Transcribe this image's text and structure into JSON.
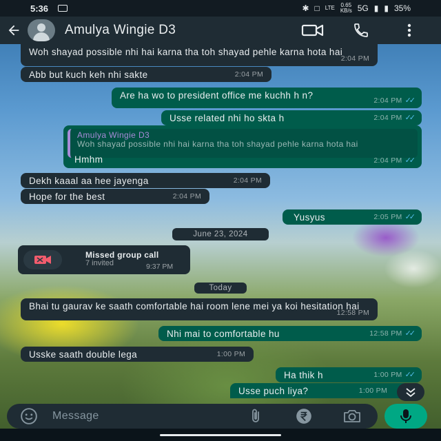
{
  "status_bar": {
    "time": "5:36",
    "lte_label": "LTE",
    "speed_value": "0.65",
    "speed_unit": "KB/s",
    "network": "5G",
    "battery": "35%"
  },
  "header": {
    "contact_name": "Amulya Wingie D3",
    "icons": [
      "back-arrow-icon",
      "avatar",
      "video-call-icon",
      "phone-icon",
      "more-options-icon"
    ]
  },
  "messages": [
    {
      "dir": "in",
      "text": "Woh shayad possible nhi hai karna tha toh shayad pehle karna hota hai",
      "time": "2:04 PM"
    },
    {
      "dir": "in",
      "text": "Abb but kuch keh nhi sakte",
      "time": "2:04 PM"
    },
    {
      "dir": "out",
      "text": "Are ha wo to president office me kuchh h n?",
      "time": "2:04 PM"
    },
    {
      "dir": "out",
      "text": "Usse related nhi ho skta h",
      "time": "2:04 PM"
    },
    {
      "dir": "out",
      "quote_author": "Amulya Wingie D3",
      "quote_text": "Woh shayad possible nhi hai karna tha toh shayad pehle karna hota hai",
      "text": "Hmhm",
      "time": "2:04 PM"
    },
    {
      "dir": "in",
      "text": "Dekh kaaal aa hee jayenga",
      "time": "2:04 PM"
    },
    {
      "dir": "in",
      "text": "Hope for the best",
      "time": "2:04 PM"
    },
    {
      "dir": "out",
      "text": "Yusyus",
      "time": "2:05 PM"
    },
    {
      "dir": "in",
      "text": "Bhai tu gaurav ke saath comfortable hai room lene mei ya koi hesitation hai",
      "time": "12:58 PM"
    },
    {
      "dir": "out",
      "text": "Nhi mai to comfortable hu",
      "time": "12:58 PM"
    },
    {
      "dir": "in",
      "text": "Usske saath double lega",
      "time": "1:00 PM"
    },
    {
      "dir": "out",
      "text": "Ha thik h",
      "time": "1:00 PM"
    },
    {
      "dir": "out",
      "text": "Usse puch liya?",
      "time": "1:00 PM"
    }
  ],
  "date_separators": [
    "June 23, 2024",
    "Today"
  ],
  "missed_call": {
    "title": "Missed group call",
    "subtitle": "7 invited",
    "time": "9:37 PM"
  },
  "input_bar": {
    "placeholder": "Message"
  },
  "colors": {
    "incoming_bubble": "#1f2c34",
    "outgoing_bubble": "#005c4b",
    "accent_green": "#00a884",
    "read_ticks": "#53bdeb",
    "quote_author": "#a78bd8",
    "missed_call_red": "#f15c6d"
  }
}
